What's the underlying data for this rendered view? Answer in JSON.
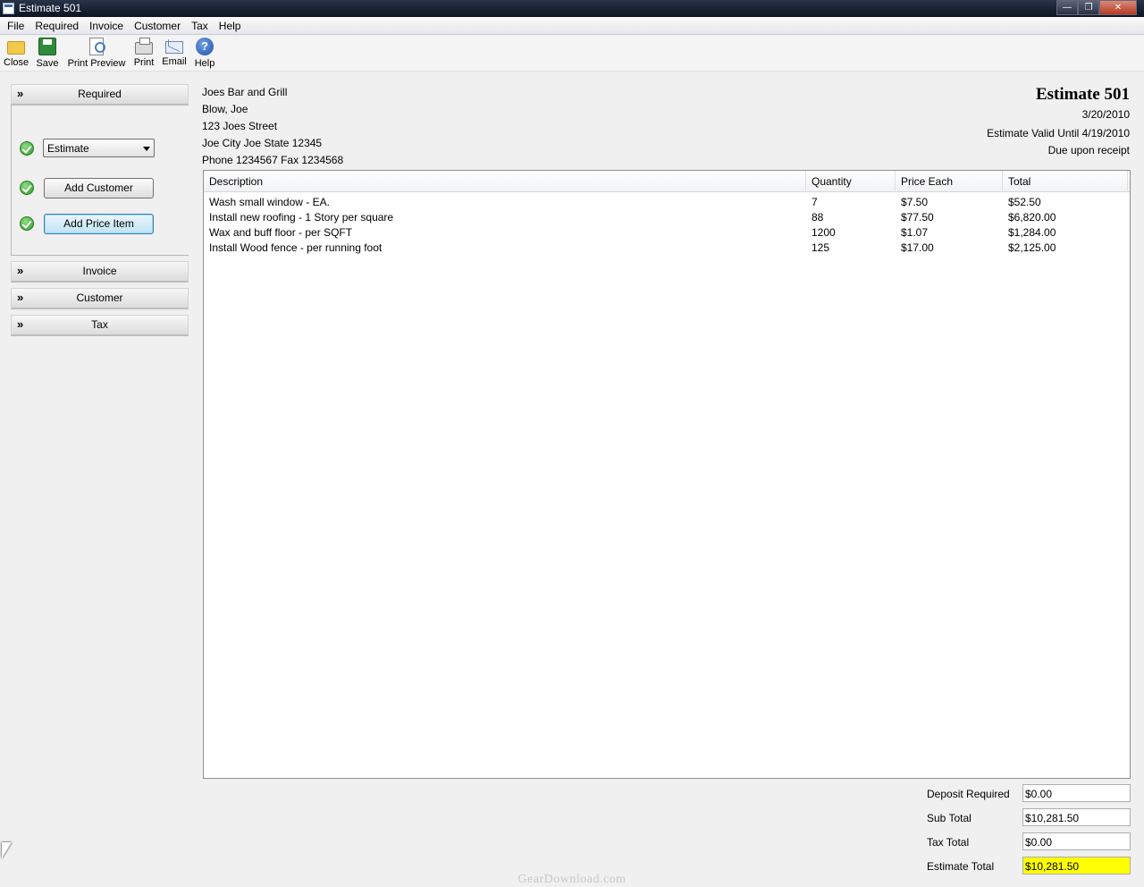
{
  "window": {
    "title": "Estimate 501"
  },
  "menu": [
    "File",
    "Required",
    "Invoice",
    "Customer",
    "Tax",
    "Help"
  ],
  "toolbar": {
    "close": "Close",
    "save": "Save",
    "print_preview": "Print Preview",
    "print": "Print",
    "email": "Email",
    "help": "Help"
  },
  "sidebar": {
    "required": {
      "header": "Required",
      "doc_type": "Estimate",
      "add_customer": "Add Customer",
      "add_price_item": "Add Price Item"
    },
    "invoice": "Invoice",
    "customer": "Customer",
    "tax": "Tax"
  },
  "customer": {
    "company": "Joes Bar and Grill",
    "contact": "Blow, Joe",
    "street": "123 Joes Street",
    "city_state_zip": "Joe City Joe State 12345",
    "phone_fax": "Phone 1234567 Fax 1234568"
  },
  "estimate": {
    "title": "Estimate 501",
    "date": "3/20/2010",
    "valid_until": "Estimate Valid Until 4/19/2010",
    "terms": "Due upon receipt"
  },
  "table": {
    "headers": {
      "description": "Description",
      "quantity": "Quantity",
      "price": "Price Each",
      "total": "Total"
    },
    "rows": [
      {
        "description": "Wash small window - EA.",
        "quantity": "7",
        "price": "$7.50",
        "total": "$52.50"
      },
      {
        "description": "Install new roofing - 1 Story per square",
        "quantity": "88",
        "price": "$77.50",
        "total": "$6,820.00"
      },
      {
        "description": "Wax and buff floor - per SQFT",
        "quantity": "1200",
        "price": "$1.07",
        "total": "$1,284.00"
      },
      {
        "description": "Install Wood fence -  per running foot",
        "quantity": "125",
        "price": "$17.00",
        "total": "$2,125.00"
      }
    ]
  },
  "totals": {
    "deposit_label": "Deposit Required",
    "deposit": "$0.00",
    "subtotal_label": "Sub Total",
    "subtotal": "$10,281.50",
    "tax_label": "Tax Total",
    "tax": "$0.00",
    "estimate_total_label": "Estimate Total",
    "estimate_total": "$10,281.50",
    "highlight_color": "#ffff00"
  },
  "watermark": "GearDownload.com"
}
